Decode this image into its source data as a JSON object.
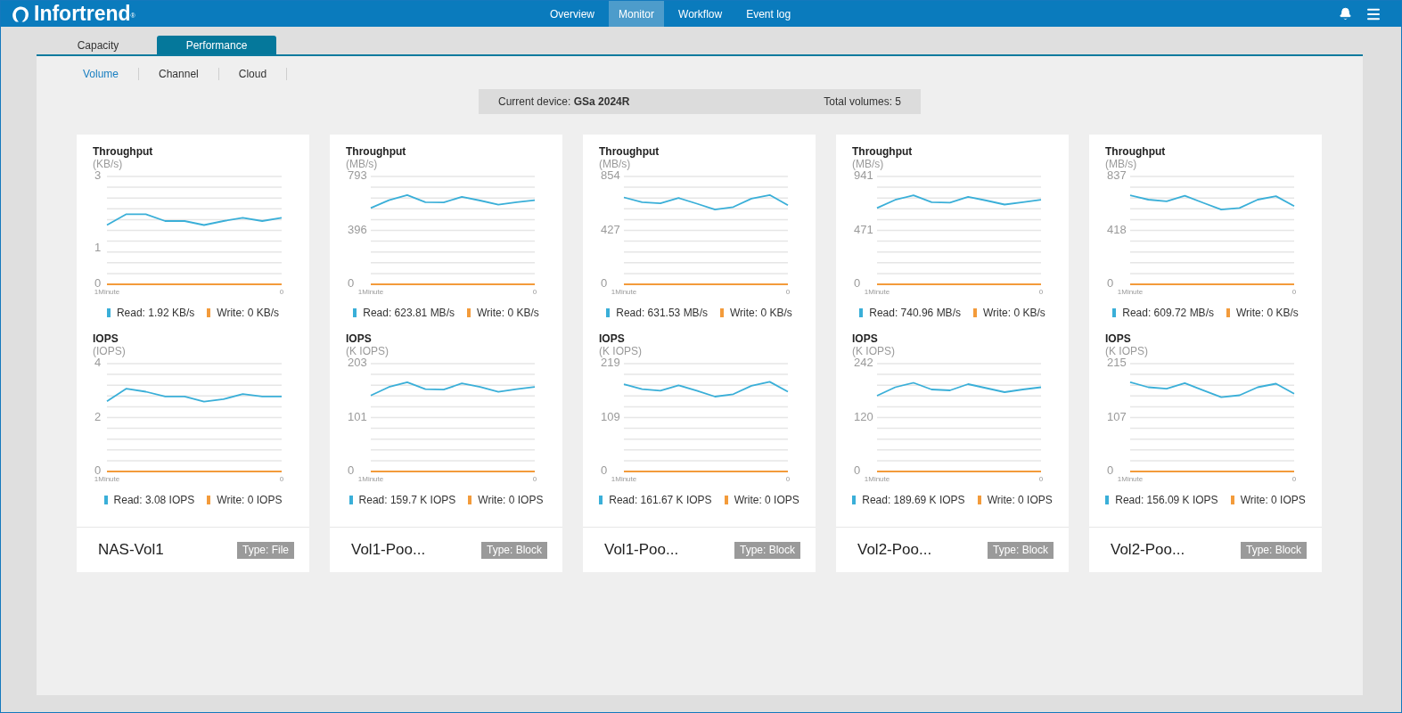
{
  "header": {
    "logo": "Infortrend$^{®}$",
    "nav": [
      {
        "label": "Overview",
        "selected": false
      },
      {
        "label": "Monitor",
        "selected": true
      },
      {
        "label": "Workflow",
        "selected": false
      },
      {
        "label": "Event log",
        "selected": false
      }
    ]
  },
  "tabs": [
    {
      "label": "Capacity",
      "selected": false
    },
    {
      "label": "Performance",
      "selected": true
    }
  ],
  "subnav": [
    {
      "label": "Volume",
      "selected": true
    },
    {
      "label": "Channel",
      "selected": false
    },
    {
      "label": "Cloud",
      "selected": false
    }
  ],
  "device_bar": {
    "device": "Current device: **GSa 2024R**",
    "total": "Total volumes: 5"
  },
  "volumes": [
    {
      "name": "NAS-Vol1",
      "type": "Type: File",
      "charts": [
        {
          "chart_data": {
            "type": "line",
            "title": "Throughput",
            "ylabel": "(KB/s)",
            "categories": [
              "1Minute",
              null,
              null,
              null,
              null,
              null,
              null,
              null,
              null,
              "0"
            ],
            "ylim": [
              0,
              3
            ],
            "yticks": [
              0,
              1,
              3
            ],
            "legend": "bottom",
            "series": [
              {
                "name": "Read: 1.92 KB/s",
                "color": "#3aafd8",
                "values": [
                  1.65,
                  1.95,
                  1.95,
                  1.76,
                  1.76,
                  1.65,
                  1.76,
                  1.85,
                  1.76,
                  1.85
                ]
              },
              {
                "name": "Write: 0 KB/s",
                "color": "#f39b3b",
                "values": [
                  0,
                  0,
                  0,
                  0,
                  0,
                  0,
                  0,
                  0,
                  0,
                  0
                ]
              }
            ]
          }
        },
        {
          "chart_data": {
            "type": "line",
            "title": "IOPS",
            "ylabel": "(IOPS)",
            "categories": [
              "1Minute",
              null,
              null,
              null,
              null,
              null,
              null,
              null,
              null,
              "0"
            ],
            "ylim": [
              0,
              4
            ],
            "yticks": [
              0,
              2,
              4
            ],
            "legend": "bottom",
            "series": [
              {
                "name": "Read: 3.08 IOPS",
                "color": "#3aafd8",
                "values": [
                  2.6,
                  3.07,
                  2.96,
                  2.78,
                  2.78,
                  2.59,
                  2.68,
                  2.87,
                  2.78,
                  2.78
                ]
              },
              {
                "name": "Write: 0 IOPS",
                "color": "#f39b3b",
                "values": [
                  0,
                  0,
                  0,
                  0,
                  0,
                  0,
                  0,
                  0,
                  0,
                  0
                ]
              }
            ]
          }
        }
      ]
    },
    {
      "name": "Vol1-Poo...",
      "type": "Type: Block",
      "charts": [
        {
          "chart_data": {
            "type": "line",
            "title": "Throughput",
            "ylabel": "(MB/s)",
            "categories": [
              "1Minute",
              null,
              null,
              null,
              null,
              null,
              null,
              null,
              null,
              "0"
            ],
            "ylim": [
              0,
              793
            ],
            "yticks": [
              0,
              396,
              793
            ],
            "legend": "bottom",
            "series": [
              {
                "name": "Read: 623.81 MB/s",
                "color": "#3aafd8",
                "values": [
                  561,
                  618,
                  657,
                  604,
                  602,
                  643,
                  616,
                  586,
                  604,
                  618
                ]
              },
              {
                "name": "Write: 0 KB/s",
                "color": "#f39b3b",
                "values": [
                  0,
                  0,
                  0,
                  0,
                  0,
                  0,
                  0,
                  0,
                  0,
                  0
                ]
              }
            ]
          }
        },
        {
          "chart_data": {
            "type": "line",
            "title": "IOPS",
            "ylabel": "(K IOPS)",
            "categories": [
              "1Minute",
              null,
              null,
              null,
              null,
              null,
              null,
              null,
              null,
              "0"
            ],
            "ylim": [
              0,
              203
            ],
            "yticks": [
              0,
              101,
              203
            ],
            "legend": "bottom",
            "series": [
              {
                "name": "Read: 159.7 K IOPS",
                "color": "#3aafd8",
                "values": [
                  143,
                  159,
                  168,
                  155,
                  154,
                  166,
                  159,
                  150,
                  155,
                  159
                ]
              },
              {
                "name": "Write: 0 IOPS",
                "color": "#f39b3b",
                "values": [
                  0,
                  0,
                  0,
                  0,
                  0,
                  0,
                  0,
                  0,
                  0,
                  0
                ]
              }
            ]
          }
        }
      ]
    },
    {
      "name": "Vol1-Poo...",
      "type": "Type: Block",
      "charts": [
        {
          "chart_data": {
            "type": "line",
            "title": "Throughput",
            "ylabel": "(MB/s)",
            "categories": [
              "1Minute",
              null,
              null,
              null,
              null,
              null,
              null,
              null,
              null,
              "0"
            ],
            "ylim": [
              0,
              854
            ],
            "yticks": [
              0,
              427,
              854
            ],
            "legend": "bottom",
            "series": [
              {
                "name": "Read: 631.53 MB/s",
                "color": "#3aafd8",
                "values": [
                  688,
                  651,
                  641,
                  683,
                  639,
                  592,
                  612,
                  678,
                  707,
                  626
                ]
              },
              {
                "name": "Write: 0 KB/s",
                "color": "#f39b3b",
                "values": [
                  0,
                  0,
                  0,
                  0,
                  0,
                  0,
                  0,
                  0,
                  0,
                  0
                ]
              }
            ]
          }
        },
        {
          "chart_data": {
            "type": "line",
            "title": "IOPS",
            "ylabel": "(K IOPS)",
            "categories": [
              "1Minute",
              null,
              null,
              null,
              null,
              null,
              null,
              null,
              null,
              "0"
            ],
            "ylim": [
              0,
              219
            ],
            "yticks": [
              0,
              109,
              219
            ],
            "legend": "bottom",
            "series": [
              {
                "name": "Read: 161.67 K IOPS",
                "color": "#3aafd8",
                "values": [
                  177,
                  167,
                  164,
                  175,
                  164,
                  152,
                  157,
                  174,
                  182,
                  162
                ]
              },
              {
                "name": "Write: 0 IOPS",
                "color": "#f39b3b",
                "values": [
                  0,
                  0,
                  0,
                  0,
                  0,
                  0,
                  0,
                  0,
                  0,
                  0
                ]
              }
            ]
          }
        }
      ]
    },
    {
      "name": "Vol2-Poo...",
      "type": "Type: Block",
      "charts": [
        {
          "chart_data": {
            "type": "line",
            "title": "Throughput",
            "ylabel": "(MB/s)",
            "categories": [
              "1Minute",
              null,
              null,
              null,
              null,
              null,
              null,
              null,
              null,
              "0"
            ],
            "ylim": [
              0,
              941
            ],
            "yticks": [
              0,
              471,
              941
            ],
            "legend": "bottom",
            "series": [
              {
                "name": "Read: 740.96 MB/s",
                "color": "#3aafd8",
                "values": [
                  666,
                  737,
                  777,
                  717,
                  712,
                  764,
                  731,
                  696,
                  717,
                  737
                ]
              },
              {
                "name": "Write: 0 KB/s",
                "color": "#f39b3b",
                "values": [
                  0,
                  0,
                  0,
                  0,
                  0,
                  0,
                  0,
                  0,
                  0,
                  0
                ]
              }
            ]
          }
        },
        {
          "chart_data": {
            "type": "line",
            "title": "IOPS",
            "ylabel": "(K IOPS)",
            "categories": [
              "1Minute",
              null,
              null,
              null,
              null,
              null,
              null,
              null,
              null,
              "0"
            ],
            "ylim": [
              0,
              242
            ],
            "yticks": [
              0,
              120,
              242
            ],
            "legend": "bottom",
            "series": [
              {
                "name": "Read: 189.69 K IOPS",
                "color": "#3aafd8",
                "values": [
                  170,
                  189,
                  199,
                  184,
                  182,
                  196,
                  187,
                  178,
                  184,
                  189
                ]
              },
              {
                "name": "Write: 0 IOPS",
                "color": "#f39b3b",
                "values": [
                  0,
                  0,
                  0,
                  0,
                  0,
                  0,
                  0,
                  0,
                  0,
                  0
                ]
              }
            ]
          }
        }
      ]
    },
    {
      "name": "Vol2-Poo...",
      "type": "Type: Block",
      "charts": [
        {
          "chart_data": {
            "type": "line",
            "title": "Throughput",
            "ylabel": "(MB/s)",
            "categories": [
              "1Minute",
              null,
              null,
              null,
              null,
              null,
              null,
              null,
              null,
              "0"
            ],
            "ylim": [
              0,
              837
            ],
            "yticks": [
              0,
              418,
              837
            ],
            "legend": "bottom",
            "series": [
              {
                "name": "Read: 609.72 MB/s",
                "color": "#3aafd8",
                "values": [
                  691,
                  657,
                  645,
                  687,
                  633,
                  580,
                  592,
                  657,
                  684,
                  607
                ]
              },
              {
                "name": "Write: 0 KB/s",
                "color": "#f39b3b",
                "values": [
                  0,
                  0,
                  0,
                  0,
                  0,
                  0,
                  0,
                  0,
                  0,
                  0
                ]
              }
            ]
          }
        },
        {
          "chart_data": {
            "type": "line",
            "title": "IOPS",
            "ylabel": "(K IOPS)",
            "categories": [
              "1Minute",
              null,
              null,
              null,
              null,
              null,
              null,
              null,
              null,
              "0"
            ],
            "ylim": [
              0,
              215
            ],
            "yticks": [
              0,
              107,
              215
            ],
            "legend": "bottom",
            "series": [
              {
                "name": "Read: 156.09 K IOPS",
                "color": "#3aafd8",
                "values": [
                  178,
                  168,
                  165,
                  176,
                  162,
                  148,
                  152,
                  168,
                  175,
                  155
                ]
              },
              {
                "name": "Write: 0 IOPS",
                "color": "#f39b3b",
                "values": [
                  0,
                  0,
                  0,
                  0,
                  0,
                  0,
                  0,
                  0,
                  0,
                  0
                ]
              }
            ]
          }
        }
      ]
    }
  ]
}
